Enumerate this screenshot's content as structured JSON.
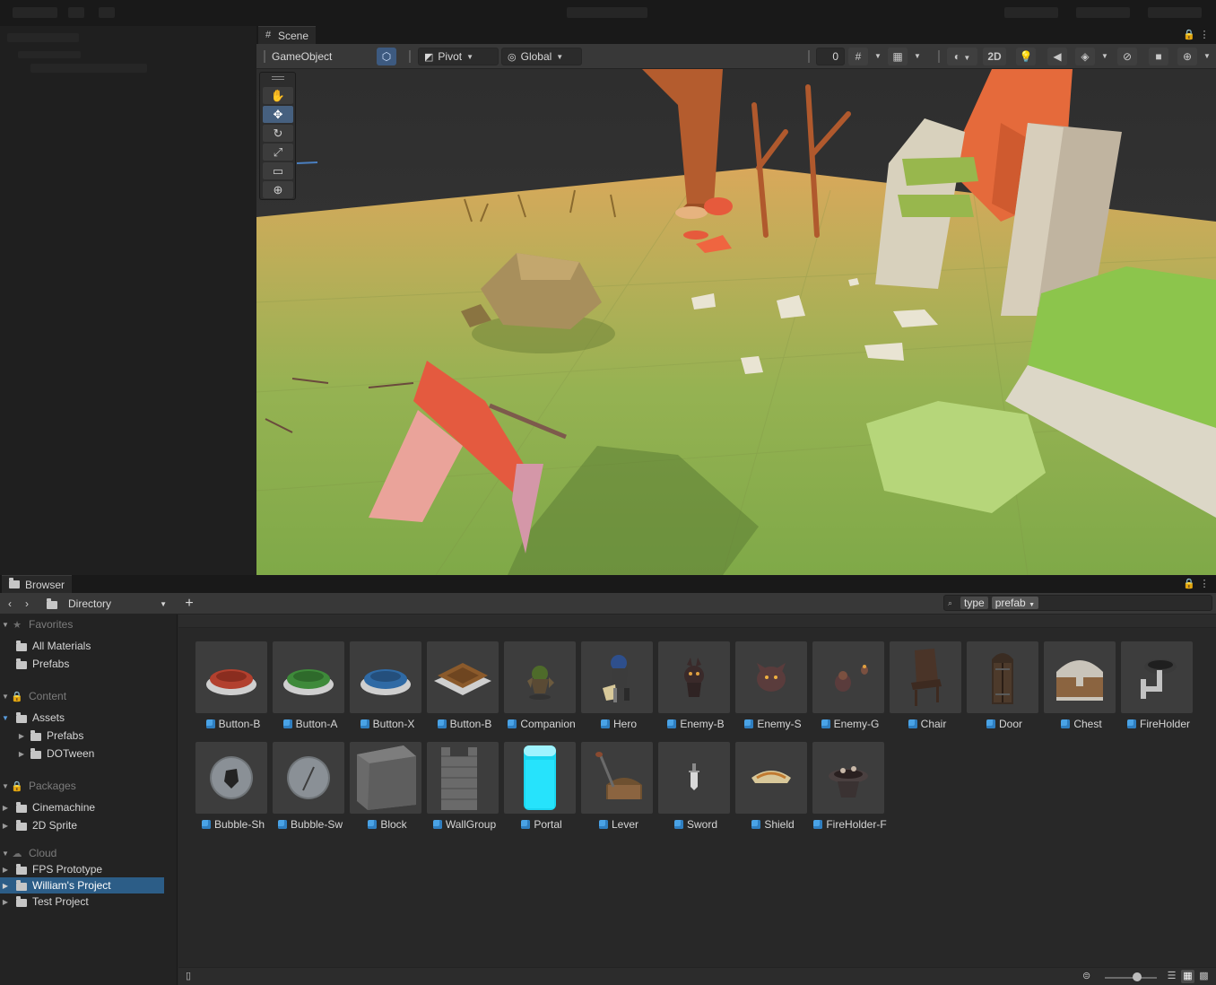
{
  "scene": {
    "tab_label": "Scene",
    "toolbar": {
      "gameobject_label": "GameObject",
      "pivot_label": "Pivot",
      "global_label": "Global",
      "snap_value": "0",
      "mode_2d_label": "2D"
    }
  },
  "browser": {
    "tab_label": "Browser",
    "directory_label": "Directory",
    "search": {
      "type_token": "type",
      "value_token": "prefab"
    },
    "sidebar": {
      "favorites_header": "Favorites",
      "favorites": [
        "All Materials",
        "Prefabs"
      ],
      "content_header": "Content",
      "assets_label": "Assets",
      "assets_children": [
        "Prefabs",
        "DOTween"
      ],
      "packages_header": "Packages",
      "packages": [
        "Cinemachine",
        "2D Sprite"
      ],
      "cloud_header": "Cloud",
      "cloud": [
        "FPS Prototype",
        "William's Project",
        "Test Project"
      ],
      "selected": "William's Project"
    },
    "assets": [
      {
        "label": "Button-B",
        "icon": "button-red"
      },
      {
        "label": "Button-A",
        "icon": "button-green"
      },
      {
        "label": "Button-X",
        "icon": "button-blue"
      },
      {
        "label": "Button-B",
        "icon": "button-wood"
      },
      {
        "label": "Companion",
        "icon": "companion"
      },
      {
        "label": "Hero",
        "icon": "hero"
      },
      {
        "label": "Enemy-B",
        "icon": "enemy-b"
      },
      {
        "label": "Enemy-S",
        "icon": "enemy-s"
      },
      {
        "label": "Enemy-G",
        "icon": "enemy-g"
      },
      {
        "label": "Chair",
        "icon": "chair"
      },
      {
        "label": "Door",
        "icon": "door"
      },
      {
        "label": "Chest",
        "icon": "chest"
      },
      {
        "label": "FireHolder",
        "icon": "fireholder"
      },
      {
        "label": "Bubble-Sh",
        "icon": "bubble-shield"
      },
      {
        "label": "Bubble-Sw",
        "icon": "bubble-sword"
      },
      {
        "label": "Block",
        "icon": "block"
      },
      {
        "label": "WallGroup",
        "icon": "wallgroup"
      },
      {
        "label": "Portal",
        "icon": "portal"
      },
      {
        "label": "Lever",
        "icon": "lever"
      },
      {
        "label": "Sword",
        "icon": "sword"
      },
      {
        "label": "Shield",
        "icon": "shield"
      },
      {
        "label": "FireHolder-F",
        "icon": "fireholder-f"
      }
    ]
  },
  "colors": {
    "selection": "#2c5d87",
    "prefab_icon": "#4aa3e6",
    "active_tool": "#46607f"
  }
}
